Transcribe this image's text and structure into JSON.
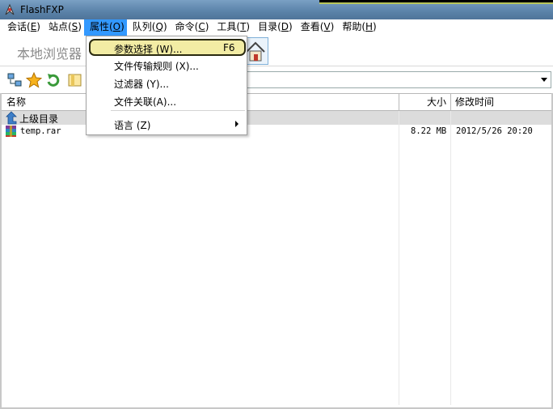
{
  "window": {
    "title": "FlashFXP"
  },
  "menubar": [
    {
      "label": "会话(E)",
      "text": "会话(",
      "key": "E",
      "tail": ")"
    },
    {
      "label": "站点(S)",
      "text": "站点(",
      "key": "S",
      "tail": ")"
    },
    {
      "label": "属性(O)",
      "text": "属性(",
      "key": "O",
      "tail": ")"
    },
    {
      "label": "队列(Q)",
      "text": "队列(",
      "key": "Q",
      "tail": ")"
    },
    {
      "label": "命令(C)",
      "text": "命令(",
      "key": "C",
      "tail": ")"
    },
    {
      "label": "工具(T)",
      "text": "工具(",
      "key": "T",
      "tail": ")"
    },
    {
      "label": "目录(D)",
      "text": "目录(",
      "key": "D",
      "tail": ")"
    },
    {
      "label": "查看(V)",
      "text": "查看(",
      "key": "V",
      "tail": ")"
    },
    {
      "label": "帮助(H)",
      "text": "帮助(",
      "key": "H",
      "tail": ")"
    }
  ],
  "local_browser": {
    "title": "本地浏览器"
  },
  "path_combo": {
    "value": ""
  },
  "list": {
    "columns": {
      "name": "名称",
      "size": "大小",
      "modified": "修改时间"
    },
    "parent_row": "上级目录",
    "files": [
      {
        "name": "temp.rar",
        "size": "8.22 MB",
        "modified": "2012/5/26 20:20"
      }
    ]
  },
  "dropdown": {
    "items": [
      {
        "label": "参数选择 (W)...",
        "shortcut": "F6"
      },
      {
        "label": "文件传输规则 (X)..."
      },
      {
        "label": "过滤器 (Y)..."
      },
      {
        "label": "文件关联(A)..."
      },
      {
        "label": "语言 (Z)"
      }
    ]
  },
  "colors": {
    "menu_active": "#3399ff",
    "highlight_fill": "#f2eca4",
    "parent_row_bg": "#dcdcdc"
  }
}
